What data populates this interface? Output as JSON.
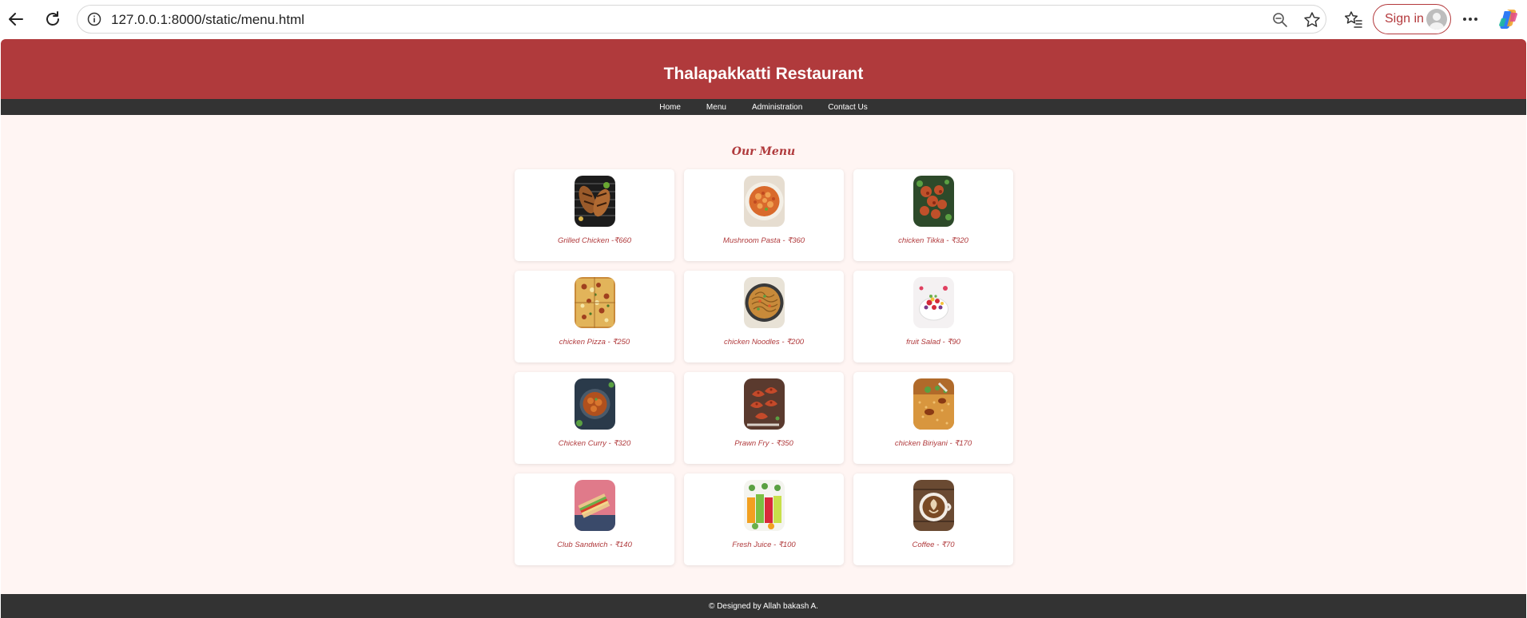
{
  "browser": {
    "url": "127.0.0.1:8000/static/menu.html",
    "sign_in_label": "Sign in"
  },
  "site": {
    "title": "Thalapakkatti Restaurant",
    "nav": [
      "Home",
      "Menu",
      "Administration",
      "Contact Us"
    ],
    "menu_heading": "Our Menu",
    "footer": "© Designed by Allah bakash A.",
    "accent_color": "#b03a3c",
    "nav_bg_color": "#333333",
    "page_bg_color": "#fff5f3"
  },
  "menu_items": [
    {
      "label": "Grilled Chicken -₹660"
    },
    {
      "label": "Mushroom Pasta - ₹360"
    },
    {
      "label": "chicken Tikka - ₹320"
    },
    {
      "label": "chicken Pizza - ₹250"
    },
    {
      "label": "chicken Noodles - ₹200"
    },
    {
      "label": "fruit Salad - ₹90"
    },
    {
      "label": "Chicken Curry - ₹320"
    },
    {
      "label": "Prawn Fry - ₹350"
    },
    {
      "label": "chicken Biriyani - ₹170"
    },
    {
      "label": "Club Sandwich - ₹140"
    },
    {
      "label": "Fresh Juice - ₹100"
    },
    {
      "label": "Coffee - ₹70"
    }
  ]
}
